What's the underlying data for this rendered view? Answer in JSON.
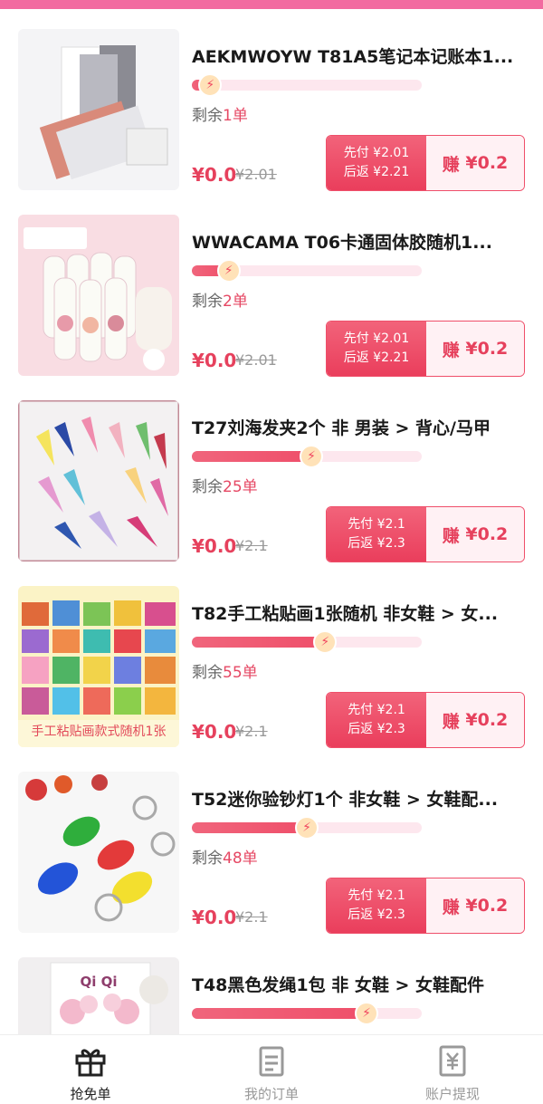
{
  "tabs": [
    {
      "label": "抢免单",
      "icon": "gift-icon",
      "active": true
    },
    {
      "label": "我的订单",
      "icon": "order-list-icon",
      "active": false
    },
    {
      "label": "账户提现",
      "icon": "yen-wallet-icon",
      "active": false
    }
  ],
  "remain_prefix": "剩余",
  "remain_suffix": "单",
  "earn_prefix": "赚",
  "pay_prefix": "先付",
  "rebate_prefix": "后返",
  "colors": {
    "accent": "#ef4f6a",
    "price": "#e6415d",
    "top_bar": "#f26aa0"
  },
  "items": [
    {
      "title": "AEKMWOYW T81A5笔记本记账本1...",
      "progress": 0.08,
      "remain": "1",
      "price": "¥0.0",
      "original": "¥2.01",
      "pay": "¥2.01",
      "rebate": "¥2.21",
      "earn": "¥0.2",
      "image": "notebooks"
    },
    {
      "title": "WWACAMA T06卡通固体胶随机1...",
      "progress": 0.16,
      "remain": "2",
      "price": "¥0.0",
      "original": "¥2.01",
      "pay": "¥2.01",
      "rebate": "¥2.21",
      "earn": "¥0.2",
      "image": "glue-sticks"
    },
    {
      "title": "T27刘海发夹2个 非 男装 > 背心/马甲",
      "progress": 0.52,
      "remain": "25",
      "price": "¥0.0",
      "original": "¥2.1",
      "pay": "¥2.1",
      "rebate": "¥2.3",
      "earn": "¥0.2",
      "image": "hair-clips"
    },
    {
      "title": "T82手工粘贴画1张随机 非女鞋 > 女...",
      "progress": 0.58,
      "remain": "55",
      "price": "¥0.0",
      "original": "¥2.1",
      "pay": "¥2.1",
      "rebate": "¥2.3",
      "earn": "¥0.2",
      "image": "sticker-art",
      "image_caption": "手工粘贴画款式随机1张"
    },
    {
      "title": "T52迷你验钞灯1个 非女鞋 > 女鞋配...",
      "progress": 0.5,
      "remain": "48",
      "price": "¥0.0",
      "original": "¥2.1",
      "pay": "¥2.1",
      "rebate": "¥2.3",
      "earn": "¥0.2",
      "image": "keychain-lights"
    },
    {
      "title": "T48黑色发绳1包 非 女鞋 > 女鞋配件",
      "progress": 0.76,
      "remain": "74",
      "price": "¥0.0",
      "original": "¥2.1",
      "pay": "¥2.1",
      "rebate": "¥2.3",
      "earn": "¥0.2",
      "image": "hair-ties",
      "image_caption": "Qi Qi"
    }
  ]
}
